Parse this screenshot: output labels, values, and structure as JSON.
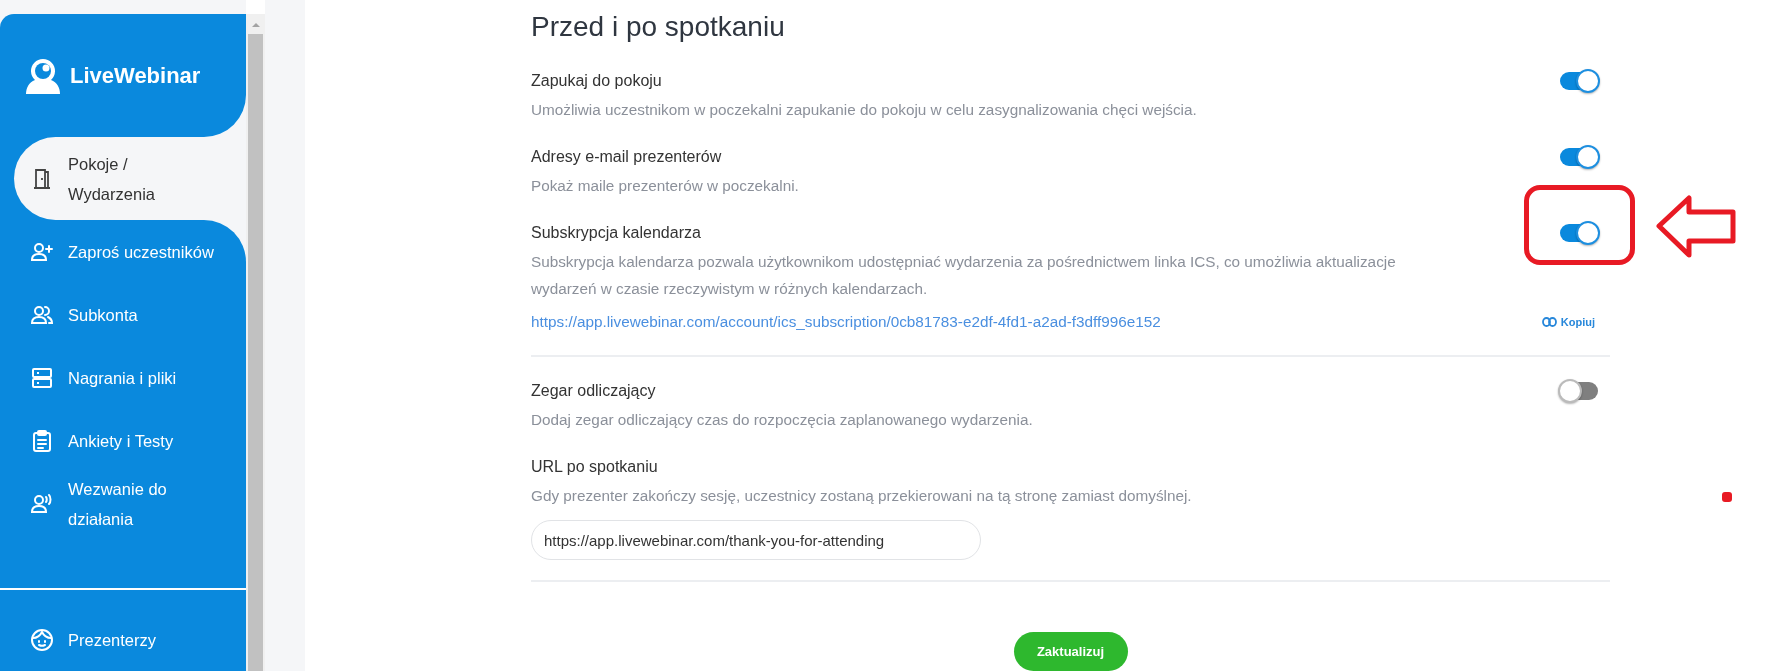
{
  "sidebar": {
    "logo": "LiveWebinar",
    "items": [
      {
        "label": "Pokoje / Wydarzenia",
        "selected": true
      },
      {
        "label": "Zaproś uczestników",
        "selected": false
      },
      {
        "label": "Subkonta",
        "selected": false
      },
      {
        "label": "Nagrania i pliki",
        "selected": false
      },
      {
        "label": "Ankiety i Testy",
        "selected": false
      },
      {
        "label": "Wezwanie do działania",
        "selected": false
      }
    ],
    "footer_items": [
      {
        "label": "Prezenterzy",
        "selected": false
      }
    ]
  },
  "section": {
    "title": "Przed i po spotkaniu",
    "groups": [
      [
        {
          "kind": "toggle",
          "label": "Zapukaj do pokoju",
          "description": "Umożliwia uczestnikom w poczekalni zapukanie do pokoju w celu zasygnalizowania chęci wejścia.",
          "on": true,
          "highlighted": false
        },
        {
          "kind": "toggle",
          "label": "Adresy e-mail prezenterów",
          "description": "Pokaż maile prezenterów w poczekalni.",
          "on": true,
          "highlighted": false
        },
        {
          "kind": "toggle",
          "label": "Subskrypcja kalendarza",
          "description": "Subskrypcja kalendarza pozwala użytkownikom udostępniać wydarzenia za pośrednictwem linka ICS, co umożliwia aktualizacje wydarzeń w czasie rzeczywistym w różnych kalendarzach.",
          "on": true,
          "highlighted": true,
          "link": "https://app.livewebinar.com/account/ics_subscription/0cb81783-e2df-4fd1-a2ad-f3dff996e152",
          "copy_label": "Kopiuj"
        }
      ],
      [
        {
          "kind": "toggle",
          "label": "Zegar odliczający",
          "description": "Dodaj zegar odliczający czas do rozpoczęcia zaplanowanego wydarzenia.",
          "on": false,
          "highlighted": false
        },
        {
          "kind": "url-input",
          "label": "URL po spotkaniu",
          "description": "Gdy prezenter zakończy sesję, uczestnicy zostaną przekierowani na tą stronę zamiast domyślnej.",
          "value": "https://app.livewebinar.com/thank-you-for-attending"
        }
      ]
    ],
    "submit": "Zaktualizuj"
  }
}
